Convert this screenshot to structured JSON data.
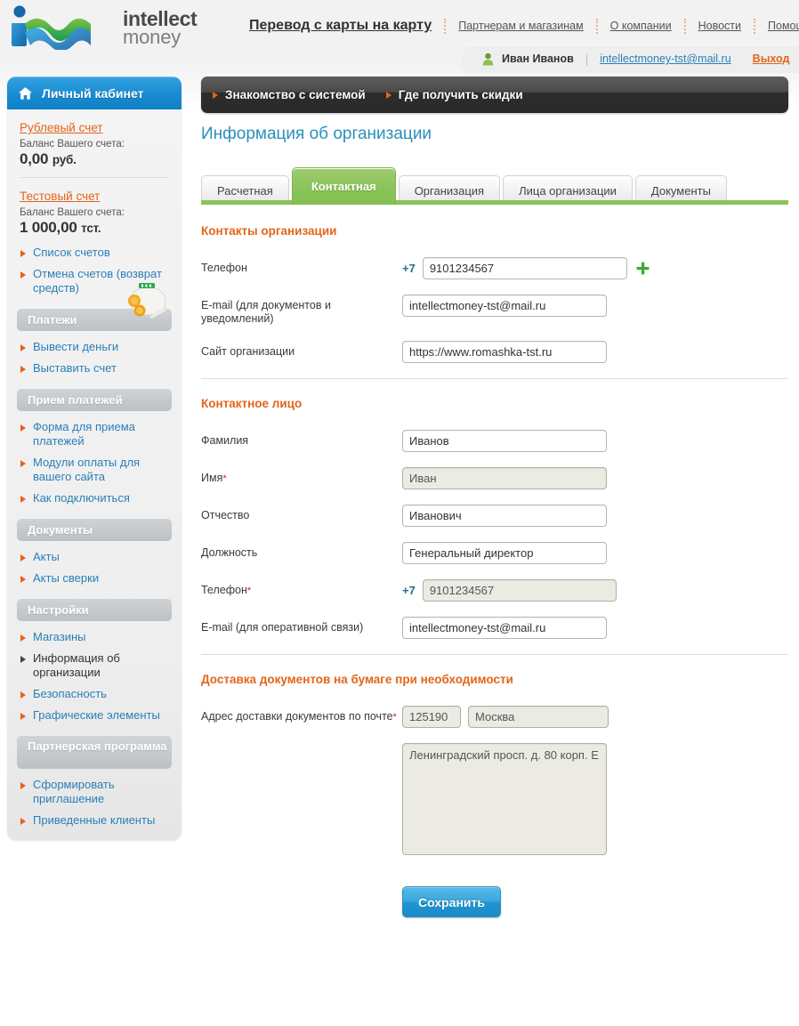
{
  "header": {
    "logo": {
      "line1": "intellect",
      "line2": "money",
      "icon": "im-wave-logo"
    },
    "main_link": "Перевод с карты на карту",
    "nav": [
      {
        "label": "Партнерам и магазинам"
      },
      {
        "label": "О компании"
      },
      {
        "label": "Новости"
      },
      {
        "label": "Помощь"
      }
    ]
  },
  "userbar": {
    "user_icon": "user-avatar-icon",
    "user_name": "Иван Иванов",
    "separator": "|",
    "email": "intellectmoney-tst@mail.ru",
    "logout": "Выход"
  },
  "banner": {
    "items": [
      {
        "label": "Знакомство с системой"
      },
      {
        "label": "Где получить скидки"
      }
    ]
  },
  "sidebar": {
    "title": "Личный кабинет",
    "title_icon": "home-icon",
    "accounts": [
      {
        "link": "Рублевый счет",
        "balance_label": "Баланс Вашего счета:",
        "amount": "0,00",
        "unit": "руб."
      },
      {
        "link": "Тестовый счет",
        "balance_label": "Баланс Вашего счета:",
        "amount": "1 000,00",
        "unit": "тст.",
        "icon": "money-bag-icon"
      }
    ],
    "top_items": [
      {
        "label": "Список счетов",
        "active": false
      },
      {
        "label": "Отмена счетов (возврат средств)",
        "active": false
      }
    ],
    "groups": [
      {
        "heading": "Платежи",
        "items": [
          {
            "label": "Вывести деньги",
            "active": false
          },
          {
            "label": "Выставить счет",
            "active": false
          }
        ]
      },
      {
        "heading": "Прием платежей",
        "items": [
          {
            "label": "Форма для приема платежей",
            "active": false
          },
          {
            "label": "Модули оплаты для вашего сайта",
            "active": false
          },
          {
            "label": "Как подключиться",
            "active": false
          }
        ]
      },
      {
        "heading": "Документы",
        "items": [
          {
            "label": "Акты",
            "active": false
          },
          {
            "label": "Акты сверки",
            "active": false
          }
        ]
      },
      {
        "heading": "Настройки",
        "items": [
          {
            "label": "Магазины",
            "active": false
          },
          {
            "label": "Информация об организации",
            "active": true
          },
          {
            "label": "Безопасность",
            "active": false
          },
          {
            "label": "Графические элементы",
            "active": false
          }
        ]
      },
      {
        "heading": "Партнерская программа",
        "items": [
          {
            "label": "Сформировать приглашение",
            "active": false
          },
          {
            "label": "Приведенные клиенты",
            "active": false
          }
        ]
      }
    ]
  },
  "main": {
    "page_title": "Информация об организации",
    "tabs": [
      {
        "label": "Расчетная",
        "active": false
      },
      {
        "label": "Контактная",
        "active": true
      },
      {
        "label": "Организация",
        "active": false
      },
      {
        "label": "Лица организации",
        "active": false
      },
      {
        "label": "Документы",
        "active": false
      }
    ],
    "sections": [
      {
        "title": "Контакты организации",
        "fields": [
          {
            "label": "Телефон",
            "required": false,
            "prefix": "+7",
            "value": "9101234567",
            "disabled": false,
            "add_icon": "plus-icon"
          },
          {
            "label": "E-mail (для документов и уведомлений)",
            "required": false,
            "value": "intellectmoney-tst@mail.ru",
            "disabled": false
          },
          {
            "label": "Сайт организации",
            "required": false,
            "value": "https://www.romashka-tst.ru",
            "disabled": false
          }
        ]
      },
      {
        "title": "Контактное лицо",
        "fields": [
          {
            "label": "Фамилия",
            "required": false,
            "value": "Иванов",
            "disabled": false
          },
          {
            "label": "Имя",
            "required": true,
            "value": "Иван",
            "disabled": true
          },
          {
            "label": "Отчество",
            "required": false,
            "value": "Иванович",
            "disabled": false
          },
          {
            "label": "Должность",
            "required": false,
            "value": "Генеральный директор",
            "disabled": false
          },
          {
            "label": "Телефон",
            "required": true,
            "prefix": "+7",
            "value": "9101234567",
            "disabled": true
          },
          {
            "label": "E-mail (для оперативной связи)",
            "required": false,
            "value": "intellectmoney-tst@mail.ru",
            "disabled": false
          }
        ]
      },
      {
        "title": "Доставка документов на бумаге при необходимости",
        "fields": [
          {
            "label": "Адрес доставки документов по почте",
            "required": true,
            "zip": "125190",
            "city": "Москва",
            "disabled": true
          },
          {
            "label": "",
            "textarea": "Ленинградский просп. д. 80 корп. Е",
            "disabled": true
          }
        ]
      }
    ],
    "save_button": "Сохранить"
  },
  "colors": {
    "accent_orange": "#e2651a",
    "link_blue": "#2a7fb8",
    "tab_green": "#8bc359",
    "button_blue": "#1f95d2",
    "title_blue": "#2a8fbd"
  }
}
